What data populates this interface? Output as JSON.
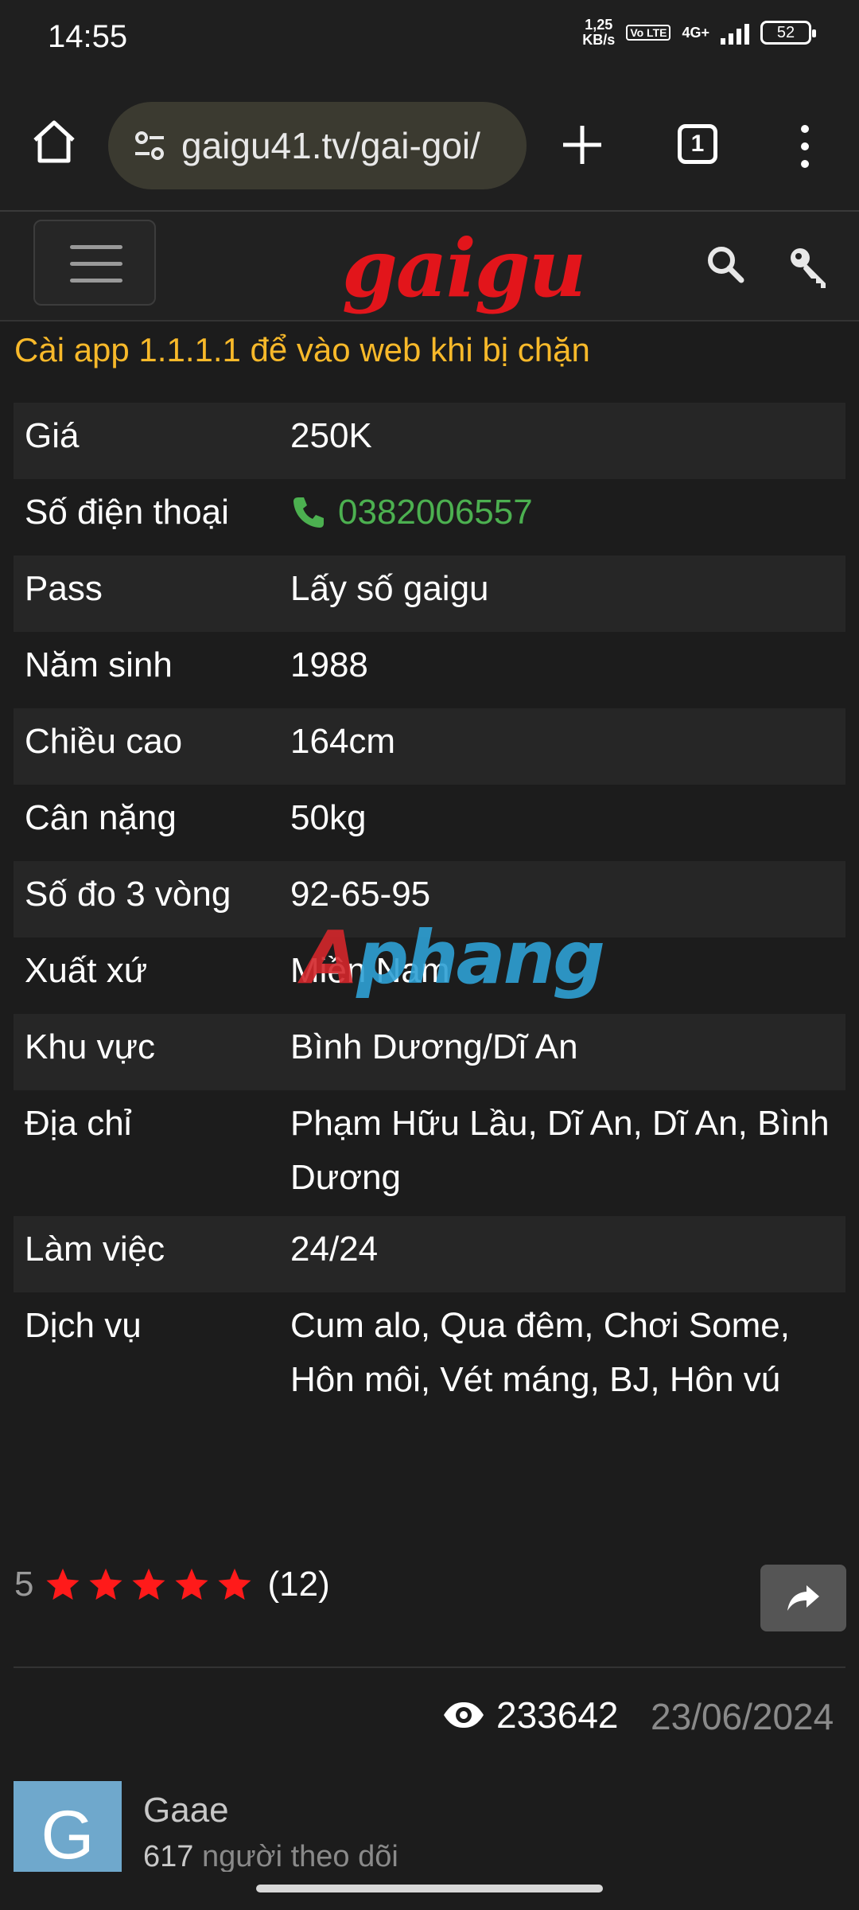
{
  "status_bar": {
    "time": "14:55",
    "net_speed_value": "1,25",
    "net_speed_unit": "KB/s",
    "volte": "Vo LTE",
    "network": "4G+",
    "battery": "52"
  },
  "browser": {
    "url": "gaigu41.tv/gai-goi/",
    "tab_count": "1"
  },
  "site": {
    "logo": "gaigu",
    "notice": "Cài app 1.1.1.1 để vào web khi bị chặn"
  },
  "info_rows": [
    {
      "label": "Giá",
      "value": "250K"
    },
    {
      "label": "Số điện thoại",
      "value": "0382006557"
    },
    {
      "label": "Pass",
      "value": "Lấy số gaigu"
    },
    {
      "label": "Năm sinh",
      "value": "1988"
    },
    {
      "label": "Chiều cao",
      "value": "164cm"
    },
    {
      "label": "Cân nặng",
      "value": "50kg"
    },
    {
      "label": "Số đo 3 vòng",
      "value": "92-65-95"
    },
    {
      "label": "Xuất xứ",
      "value": "Miền Nam"
    },
    {
      "label": "Khu vực",
      "value": "Bình Dương/Dĩ An"
    },
    {
      "label": "Địa chỉ",
      "value": "Phạm Hữu Lầu, Dĩ An, Dĩ An, Bình Dương"
    },
    {
      "label": "Làm việc",
      "value": "24/24"
    },
    {
      "label": "Dịch vụ",
      "value": "Cum alo, Qua đêm, Chơi Some, Hôn môi, Vét máng, BJ, Hôn vú"
    }
  ],
  "watermark": {
    "part1": "A",
    "part2": "phang"
  },
  "rating": {
    "score": "5",
    "stars": 5,
    "count": "(12)"
  },
  "stats": {
    "views": "233642",
    "date": "23/06/2024"
  },
  "author": {
    "initial": "G",
    "name": "Gaae",
    "followers_count": "617",
    "followers_label": "người theo dõi"
  },
  "colors": {
    "accent_yellow": "#f8b92a",
    "logo_red": "#e2151b",
    "phone_green": "#4cb050",
    "star_red": "#ff1a1a"
  }
}
